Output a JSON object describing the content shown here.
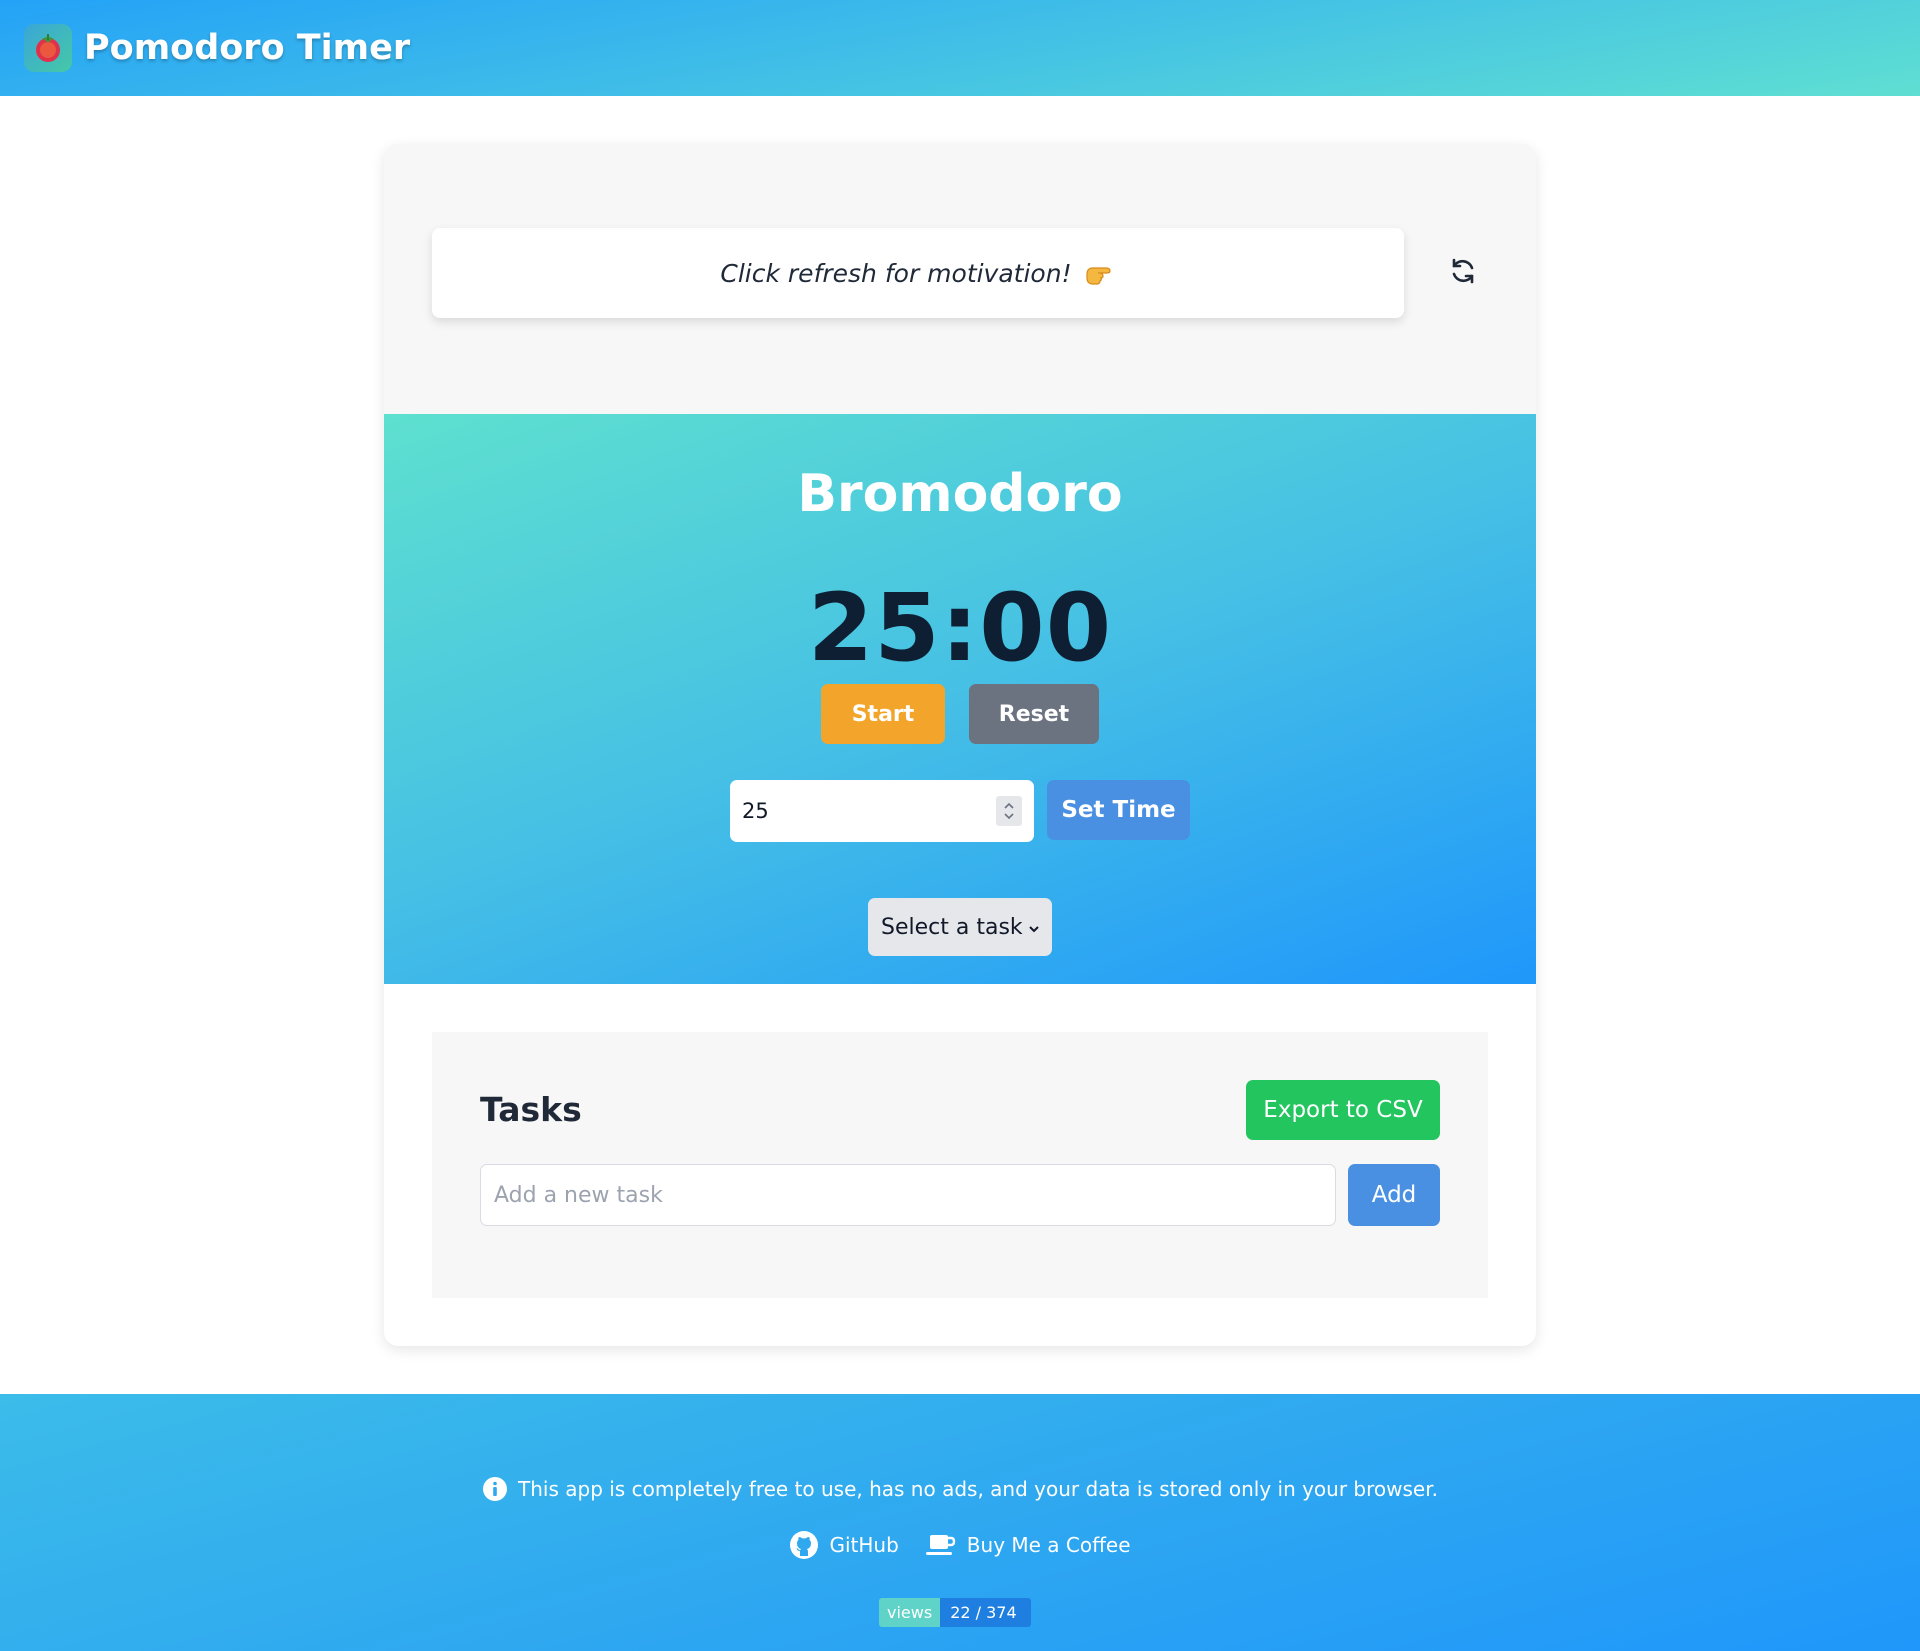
{
  "header": {
    "title": "Pomodoro Timer",
    "logo_icon": "tomato-logo-icon"
  },
  "motivation": {
    "text": "Click refresh for motivation!",
    "point_icon": "pointing-hand-icon",
    "refresh_icon": "refresh-icon"
  },
  "timer": {
    "title": "Bromodoro",
    "display": "25:00",
    "start_label": "Start",
    "reset_label": "Reset",
    "minutes_value": "25",
    "set_time_label": "Set Time",
    "task_select_value": "Select a task"
  },
  "tasks": {
    "title": "Tasks",
    "export_label": "Export to CSV",
    "input_placeholder": "Add a new task",
    "add_label": "Add"
  },
  "footer": {
    "note": "This app is completely free to use, has no ads, and your data is stored only in your browser.",
    "github_label": "GitHub",
    "coffee_label": "Buy Me a Coffee",
    "views_label": "views",
    "views_count": "22 / 374"
  },
  "colors": {
    "header_gradient_start": "#24a2f7",
    "header_gradient_end": "#5fdfd2",
    "start_button": "#f2a52a",
    "reset_button": "#6b7280",
    "primary_button": "#4a90e2",
    "export_button": "#22c55e"
  }
}
